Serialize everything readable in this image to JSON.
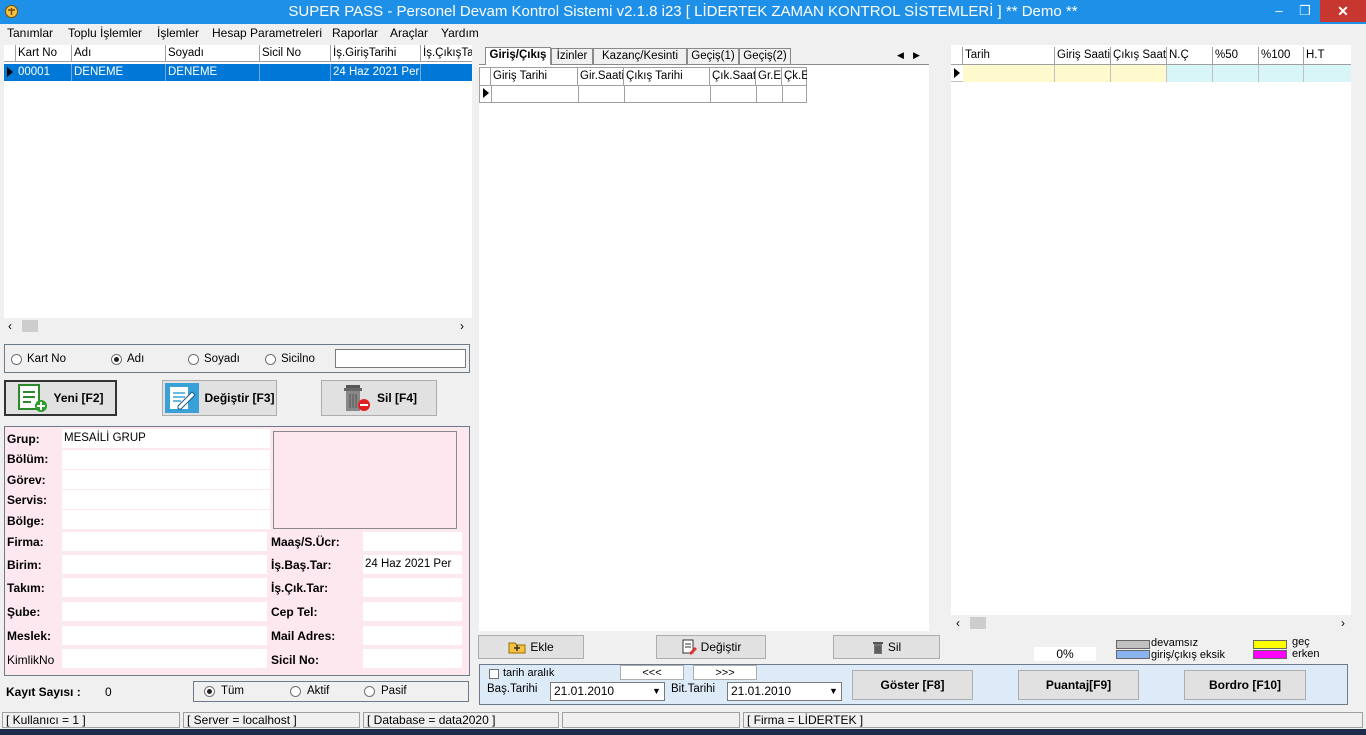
{
  "window": {
    "title": "SUPER PASS - Personel Devam Kontrol Sistemi v2.1.8 i23 [ LİDERTEK ZAMAN KONTROL  SİSTEMLERİ ]    ** Demo **",
    "minimize": "–",
    "restore": "❐",
    "close": "✕"
  },
  "menu": [
    "Tanımlar",
    "Toplu İşlemler",
    "İşlemler",
    "Hesap Parametreleri",
    "Raporlar",
    "Araçlar",
    "Yardım"
  ],
  "personnel_grid": {
    "headers": [
      "Kart No",
      "Adı",
      "Soyadı",
      "Sicil No",
      "İş.GirişTarihi",
      "İş.ÇıkışTa"
    ],
    "rows": [
      [
        "00001",
        "DENEME",
        "DENEME",
        "",
        "24 Haz 2021 Per",
        ""
      ]
    ]
  },
  "search": {
    "options": [
      "Kart No",
      "Adı",
      "Soyadı",
      "Sicilno"
    ],
    "selected": "Adı",
    "value": ""
  },
  "actions": {
    "new": "Yeni [F2]",
    "edit": "Değiştir [F3]",
    "delete": "Sil [F4]"
  },
  "details": {
    "grup_label": "Grup:",
    "grup": "MESAİLİ GRUP",
    "bolum_label": "Bölüm:",
    "gorev_label": "Görev:",
    "servis_label": "Servis:",
    "bolge_label": "Bölge:",
    "firma_label": "Firma:",
    "birim_label": "Birim:",
    "takim_label": "Takım:",
    "sube_label": "Şube:",
    "meslek_label": "Meslek:",
    "kimlik_label": "KimlikNo",
    "maas_label": "Maaş/S.Ücr:",
    "isbas_label": "İş.Baş.Tar:",
    "isbas": "24 Haz 2021 Per",
    "iscik_label": "İş.Çık.Tar:",
    "cep_label": "Cep Tel:",
    "mail_label": "Mail Adres:",
    "sicil_label": "Sicil No:"
  },
  "record_count": {
    "label": "Kayıt Sayısı :",
    "value": "0"
  },
  "filter": {
    "options": [
      "Tüm",
      "Aktif",
      "Pasif"
    ],
    "selected": "Tüm"
  },
  "tabs": [
    "Giriş/Çıkış",
    "İzinler",
    "Kazanç/Kesinti",
    "Geçiş(1)",
    "Geçiş(2)"
  ],
  "tab_nav": {
    "prev": "◀",
    "next": "▶"
  },
  "entry_grid": {
    "headers": [
      "Giriş Tarihi",
      "Gir.Saati",
      "Çıkış Tarihi",
      "Çık.Saati",
      "Gr.E",
      "Çk.E"
    ]
  },
  "entry_actions": {
    "add": "Ekle",
    "edit": "Değiştir",
    "delete": "Sil"
  },
  "summary_grid": {
    "headers": [
      "Tarih",
      "Giriş Saati",
      "Çıkış Saati",
      "N.Ç",
      "%50",
      "%100",
      "H.T"
    ]
  },
  "progress": "0%",
  "legend": [
    {
      "label": "devamsız",
      "color": "#c0c0c0"
    },
    {
      "label": "giriş/çıkış eksik",
      "color": "#8ab4f0"
    },
    {
      "label": "geç",
      "color": "#ffff00"
    },
    {
      "label": "erken",
      "color": "#ff00ff"
    }
  ],
  "date_range": {
    "check_label": "tarih aralık",
    "prev": "<<<",
    "next": ">>>",
    "start_label": "Baş.Tarihi",
    "start": "21.01.2010",
    "end_label": "Bit.Tarihi",
    "end": "21.01.2010"
  },
  "report_actions": {
    "show": "Göster [F8]",
    "puantaj": "Puantaj[F9]",
    "bordro": "Bordro [F10]"
  },
  "status": {
    "user": "[ Kullanıcı = 1 ]",
    "server": "[ Server = localhost ]",
    "database": "[ Database = data2020 ]",
    "empty": "",
    "firm": "[ Firma = LİDERTEK ]"
  },
  "colors": {
    "titlebar": "#1e90e8",
    "selection": "#0078d7",
    "detail_bg": "#fde8ef",
    "summary_highlight": "#fffacd",
    "summary_cyan": "#d8f5f8",
    "report_bar": "#ddeaf8"
  }
}
